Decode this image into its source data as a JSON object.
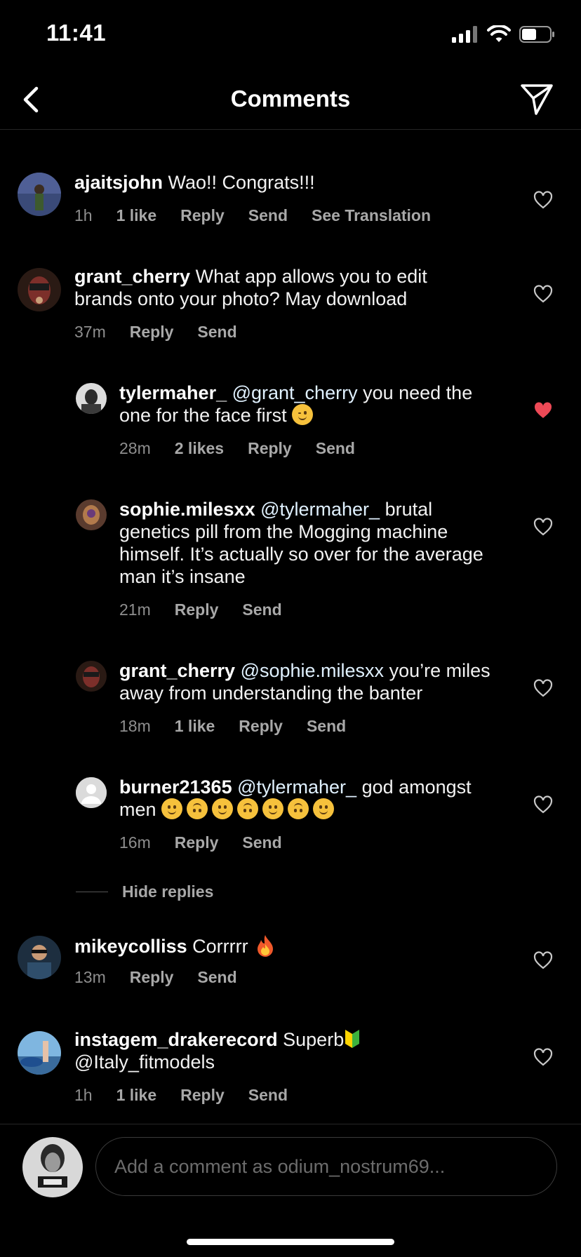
{
  "status": {
    "time": "11:41"
  },
  "header": {
    "title": "Comments"
  },
  "comments": [
    {
      "user": "ajaitsjohn",
      "text": " Wao!! Congrats!!!",
      "time": "1h",
      "likes": "1 like",
      "reply": "Reply",
      "send": "Send",
      "translate": "See Translation",
      "liked": false
    },
    {
      "user": "grant_cherry",
      "text": " What app allows you to edit brands onto your photo? May download",
      "time": "37m",
      "reply": "Reply",
      "send": "Send",
      "liked": false
    },
    {
      "user": "tylermaher_",
      "mention": " @grant_cherry",
      "text": " you need the one for the face first ",
      "time": "28m",
      "likes": "2 likes",
      "reply": "Reply",
      "send": "Send",
      "liked": true
    },
    {
      "user": "sophie.milesxx",
      "mention": " @tylermaher_",
      "text": " brutal genetics pill from the Mogging machine himself. It’s actually so over for the average man it’s insane",
      "time": "21m",
      "reply": "Reply",
      "send": "Send",
      "liked": false
    },
    {
      "user": "grant_cherry",
      "mention": " @sophie.milesxx",
      "text": " you’re miles away from understanding the banter",
      "time": "18m",
      "likes": "1 like",
      "reply": "Reply",
      "send": "Send",
      "liked": false
    },
    {
      "user": "burner21365",
      "mention": " @tylermaher_",
      "text": " god amongst men",
      "time": "16m",
      "reply": "Reply",
      "send": "Send",
      "liked": false
    },
    {
      "user": "mikeycolliss",
      "text": " Corrrrr ",
      "time": "13m",
      "reply": "Reply",
      "send": "Send",
      "liked": false
    },
    {
      "user": "instagem_drakerecord",
      "text": " Superb",
      "text2": "@Italy_fitmodels",
      "time": "1h",
      "likes": "1 like",
      "reply": "Reply",
      "send": "Send",
      "liked": false
    }
  ],
  "hide_replies": "Hide replies",
  "composer": {
    "placeholder": "Add a comment as odium_nostrum69..."
  },
  "colors": {
    "background": "#000000",
    "muted": "#8e8e8e",
    "liked_heart": "#ed4956"
  }
}
